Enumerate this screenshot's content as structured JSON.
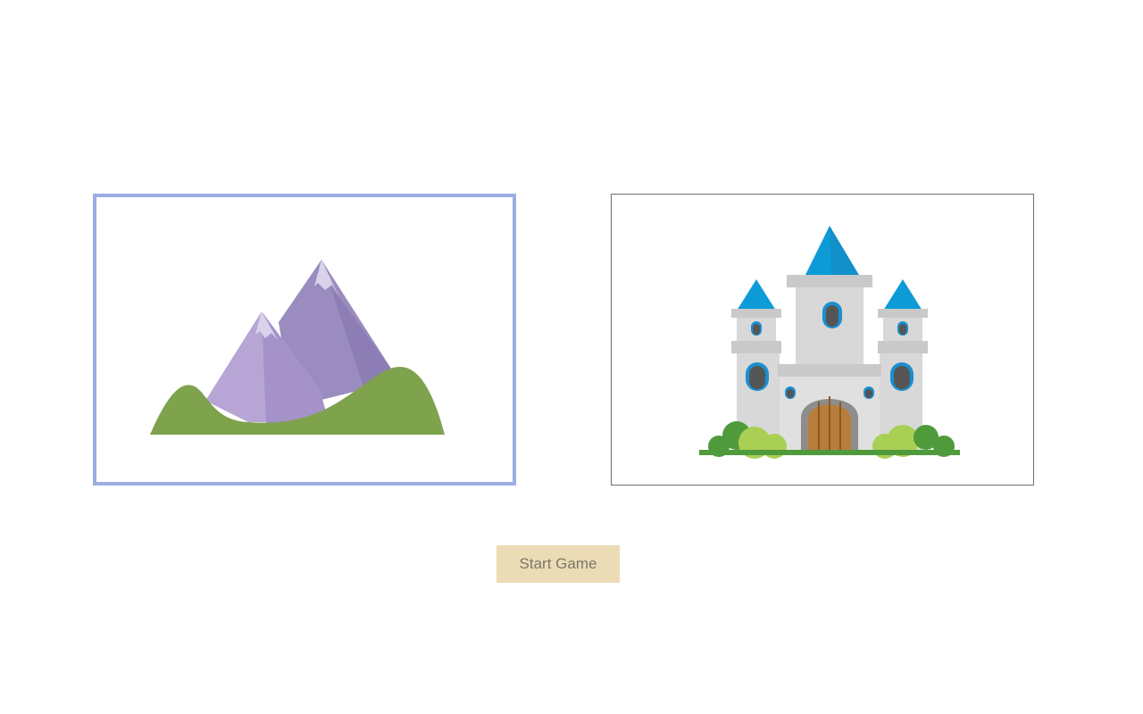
{
  "choices": [
    {
      "id": "mountain",
      "icon": "mountain-icon",
      "selected": true
    },
    {
      "id": "castle",
      "icon": "castle-icon",
      "selected": false
    }
  ],
  "start_button": {
    "label": "Start Game"
  },
  "colors": {
    "selected_border": "#9aaee2",
    "card_border": "#6e6e6e",
    "button_background": "#ecdcb6",
    "button_text": "#7d7768",
    "mountain_purple": "#a996c9",
    "mountain_snow": "#d9d2ea",
    "hill_green": "#7fa24d",
    "castle_stone": "#d6d6d6",
    "castle_roof": "#0d9bd8",
    "castle_door": "#b87d3a",
    "bush_green": "#a9cf54"
  }
}
